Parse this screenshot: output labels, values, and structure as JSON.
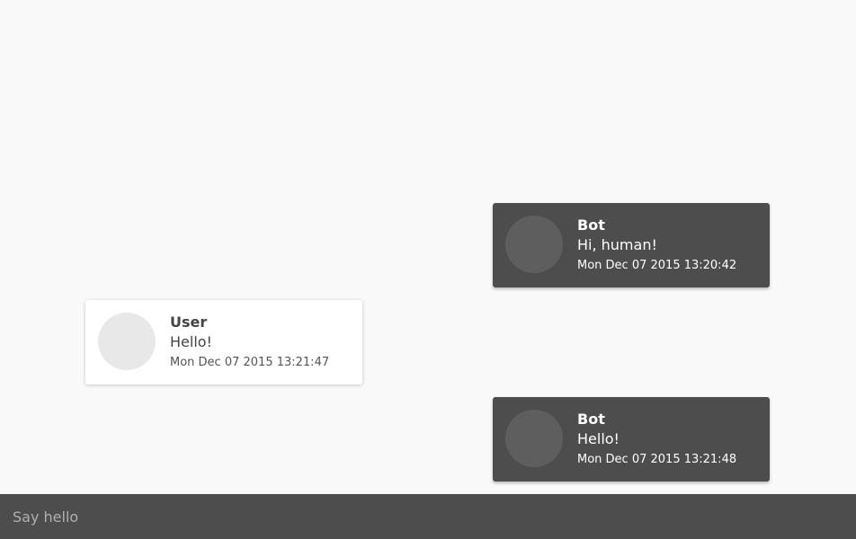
{
  "messages": [
    {
      "sender": "Bot",
      "text": "Hi, human!",
      "time": "Mon Dec 07 2015 13:20:42",
      "role": "bot"
    },
    {
      "sender": "User",
      "text": "Hello!",
      "time": "Mon Dec 07 2015 13:21:47",
      "role": "user"
    },
    {
      "sender": "Bot",
      "text": "Hello!",
      "time": "Mon Dec 07 2015 13:21:48",
      "role": "bot"
    }
  ],
  "input": {
    "placeholder": "Say hello",
    "value": ""
  },
  "colors": {
    "background": "#f9f9f9",
    "bot_bubble": "#4d4d4d",
    "user_bubble": "#ffffff",
    "input_bar": "#4d4d4d"
  }
}
